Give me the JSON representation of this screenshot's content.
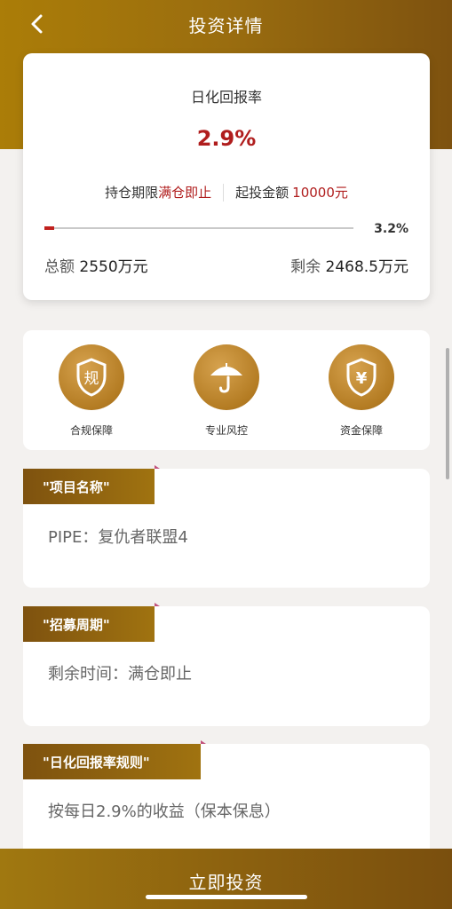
{
  "header": {
    "title": "投资详情"
  },
  "summary": {
    "rate_label": "日化回报率",
    "rate_value": "2.9%",
    "holding_label": "持仓期限",
    "holding_value": "满仓即止",
    "min_invest_label": "起投金额",
    "min_invest_value": "10000元",
    "progress_percent": 3.2,
    "progress_text": "3.2%",
    "total_label": "总额",
    "total_value": "2550万元",
    "remaining_label": "剩余",
    "remaining_value": "2468.5万元"
  },
  "features": [
    {
      "icon": "shield-regulation-icon",
      "glyph": "规",
      "label": "合规保障"
    },
    {
      "icon": "umbrella-icon",
      "glyph": "",
      "label": "专业风控"
    },
    {
      "icon": "shield-yen-icon",
      "glyph": "¥",
      "label": "资金保障"
    }
  ],
  "sections": {
    "project": {
      "tag": "\"项目名称\"",
      "body": "PIPE：复仇者联盟4"
    },
    "period": {
      "tag": "\"招募周期\"",
      "body": "剩余时间：满仓即止"
    },
    "rule": {
      "tag": "\"日化回报率规则\"",
      "body": "按每日2.9%的收益（保本保息）"
    }
  },
  "footer": {
    "invest_button": "立即投资"
  },
  "colors": {
    "brand_gold": "#9a6d0f",
    "accent_red": "#b01d1d"
  }
}
